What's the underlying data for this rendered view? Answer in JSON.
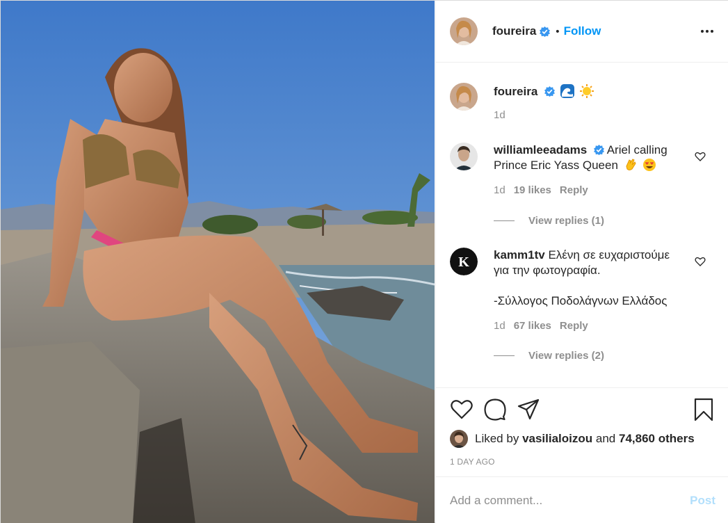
{
  "header": {
    "username": "foureira",
    "separator": "•",
    "follow_label": "Follow",
    "more_icon": "more-options-icon"
  },
  "caption": {
    "username": "foureira",
    "emojis": [
      "wave-emoji",
      "sun-emoji"
    ],
    "time": "1d"
  },
  "comments": [
    {
      "username": "williamleeadams",
      "verified": true,
      "text_line1": "Ariel calling",
      "text_line2": "Prince Eric Yass Queen",
      "emojis": [
        "clapping-hands-emoji",
        "heart-eyes-emoji"
      ],
      "time": "1d",
      "likes": "19 likes",
      "reply": "Reply",
      "view_replies": "View replies (1)"
    },
    {
      "username": "kamm1tv",
      "text_line1": "Ελένη σε ευχαριστούμε",
      "text_line2": "για την φωτογραφία.",
      "text_line3": "-Σύλλογος Ποδολάγνων Ελλάδος",
      "time": "1d",
      "likes": "67 likes",
      "reply": "Reply",
      "view_replies": "View replies (2)"
    }
  ],
  "likes": {
    "prefix": "Liked by",
    "user": "vasilialoizou",
    "and": "and",
    "count": "74,860 others"
  },
  "posted_ago": "1 DAY AGO",
  "add_comment": {
    "placeholder": "Add a comment...",
    "post_label": "Post"
  },
  "colors": {
    "accent": "#0095f6",
    "post_disabled": "#b2dffc",
    "muted": "#8e8e8e",
    "text": "#262626"
  }
}
